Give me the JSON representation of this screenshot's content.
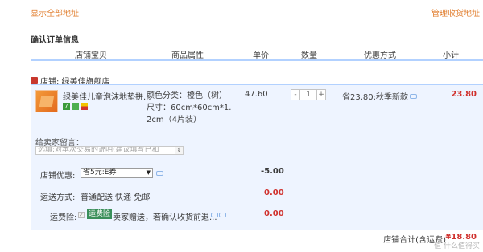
{
  "links": {
    "show_all_addresses": "显示全部地址",
    "manage_addresses": "管理收货地址"
  },
  "section_title": "确认订单信息",
  "columns": [
    "店铺宝贝",
    "商品属性",
    "单价",
    "数量",
    "优惠方式",
    "小计"
  ],
  "shop": {
    "label": "店铺: 绿美佳旗舰店"
  },
  "item": {
    "name": "绿美佳儿童泡沫地垫拼...",
    "badge_number": "7",
    "attr_color": "颜色分类：橙色（树）",
    "attr_size_1": "尺寸：60cm*60cm*1.",
    "attr_size_2": "2cm（4片装）",
    "price": "47.60",
    "qty_minus": "-",
    "qty": "1",
    "qty_plus": "+",
    "promo": "省23.80:秋季新款",
    "subtotal": "23.80"
  },
  "message": {
    "label": "给卖家留言：",
    "placeholder": "选填:对本次交易的说明(建议填写已和"
  },
  "shop_discount": {
    "label": "店铺优惠:",
    "selected": "省5元:E券",
    "amount": "-5.00"
  },
  "shipping": {
    "label": "运送方式:",
    "value": "普通配送 快递 免邮",
    "amount": "0.00"
  },
  "insurance": {
    "label": "运费险:",
    "tag": "运费险",
    "value": "卖家赠送，若确认收货前退...",
    "amount": "0.00"
  },
  "total": {
    "label": "店铺合计(含运费)",
    "amount": "¥18.80"
  },
  "watermark": "值 什么值得买",
  "colors": {
    "accent": "#e07b2a",
    "price_red": "#d0312d",
    "row_bg": "#eef4ff",
    "header_rule": "#b2d1ff"
  }
}
